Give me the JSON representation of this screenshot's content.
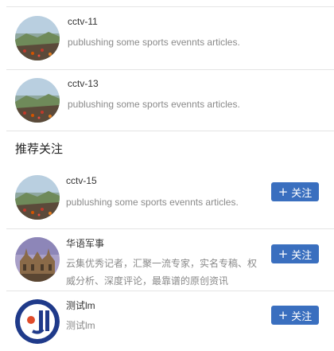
{
  "followed_list": [
    {
      "name": "cctv-11",
      "description": "publushing some sports evennts articles."
    },
    {
      "name": "cctv-13",
      "description": "publushing some sports evennts articles."
    }
  ],
  "recommend": {
    "title": "推荐关注",
    "follow_icon": "plus-icon",
    "items": [
      {
        "name": "cctv-15",
        "description": "publushing some sports evennts articles.",
        "follow_label": "关注"
      },
      {
        "name": "华语军事",
        "description": "云集优秀记者，汇聚一流专家，实名专稿、权威分析、深度评论，最靠谱的原创资讯",
        "follow_label": "关注"
      },
      {
        "name": "测试lm",
        "description": "测试lm",
        "follow_label": "关注"
      }
    ]
  }
}
